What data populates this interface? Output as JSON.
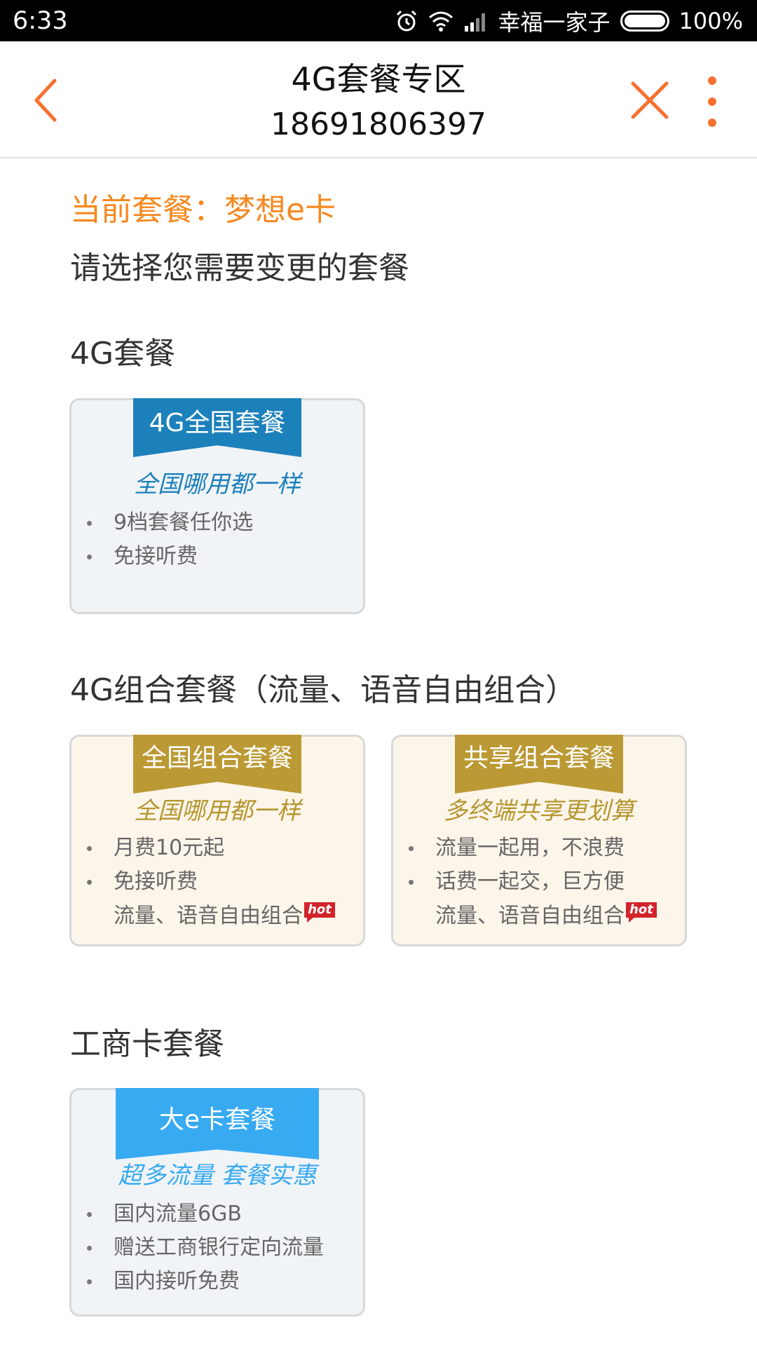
{
  "status_bar": {
    "time": "6:33",
    "carrier": "幸福一家子",
    "battery": "100%",
    "icons": [
      "alarm-icon",
      "wifi-icon",
      "signal-icon",
      "battery-icon"
    ]
  },
  "header": {
    "title": "4G套餐专区",
    "phone": "18691806397",
    "accent_color": "#f7702f",
    "icons": [
      "back-icon",
      "close-icon",
      "more-icon"
    ]
  },
  "current_plan": "当前套餐：梦想e卡",
  "prompt": "请选择您需要变更的套餐",
  "sections": [
    {
      "title": "4G套餐",
      "cards": [
        {
          "ribbon": "4G全国套餐",
          "slogan": "全国哪用都一样",
          "features": [
            "9档套餐任你选",
            "免接听费"
          ]
        }
      ]
    },
    {
      "title": "4G组合套餐（流量、语音自由组合）",
      "cards": [
        {
          "ribbon": "全国组合套餐",
          "slogan": "全国哪用都一样",
          "features": [
            "月费10元起",
            "免接听费"
          ],
          "extra": "流量、语音自由组合",
          "badge": "hot"
        },
        {
          "ribbon": "共享组合套餐",
          "slogan": "多终端共享更划算",
          "features": [
            "流量一起用，不浪费",
            "话费一起交，巨方便"
          ],
          "extra": "流量、语音自由组合",
          "badge": "hot"
        }
      ]
    },
    {
      "title": "工商卡套餐",
      "cards": [
        {
          "ribbon": "大e卡套餐",
          "slogan": "超多流量 套餐实惠",
          "features": [
            "国内流量6GB",
            "赠送工商银行定向流量",
            "国内接听免费"
          ]
        }
      ]
    }
  ],
  "colors": {
    "orange": "#f7881f",
    "blue": "#1c80bb",
    "gold": "#bb9934",
    "sky": "#38aaf1",
    "hot_red": "#d2232a"
  }
}
